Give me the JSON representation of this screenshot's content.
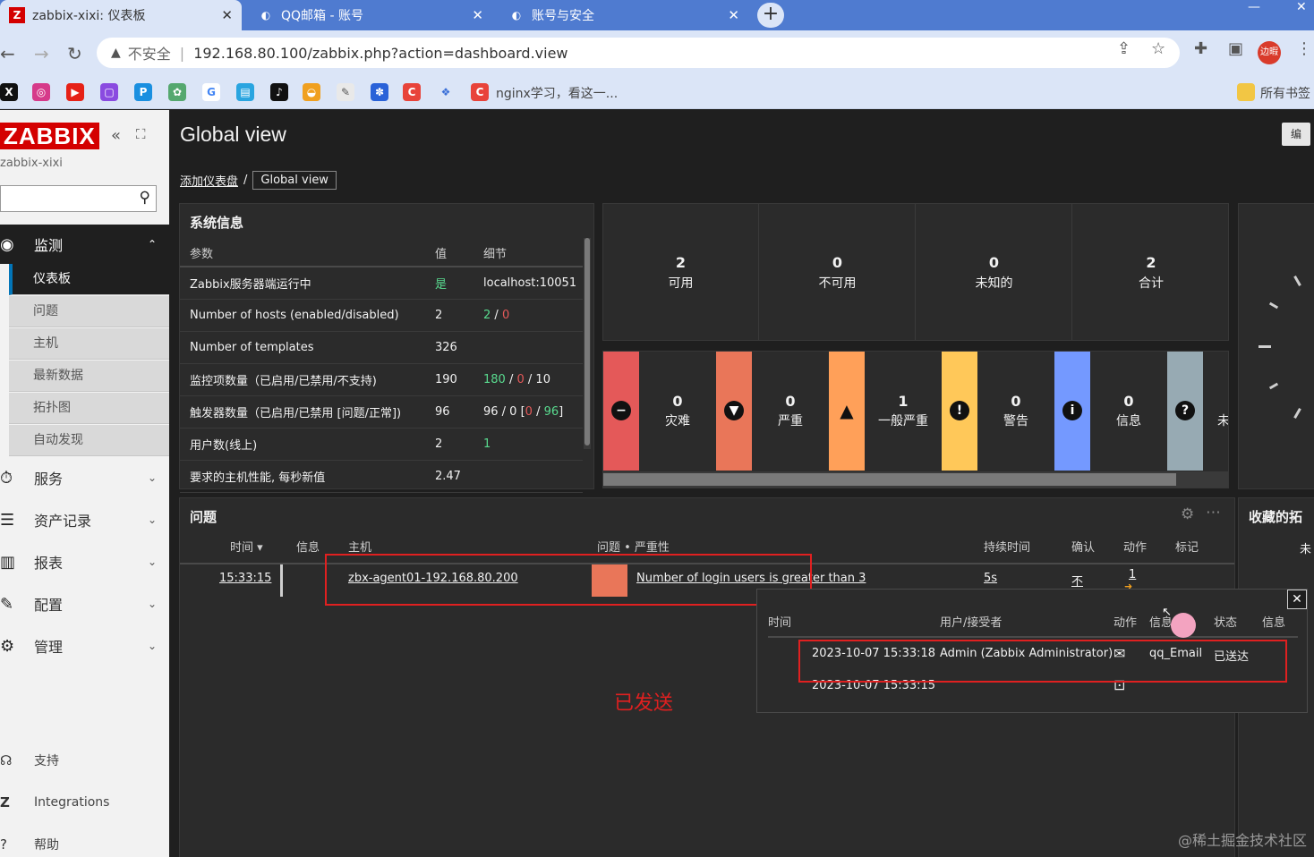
{
  "browser": {
    "tabs": [
      {
        "title": "zabbix-xixi: 仪表板",
        "icon": "Z"
      },
      {
        "title": "QQ邮箱 - 账号",
        "icon": "◐"
      },
      {
        "title": "账号与安全",
        "icon": "◐"
      }
    ],
    "insecure_label": "不安全",
    "url": "192.168.80.100/zabbix.php?action=dashboard.view",
    "profile_label": "边暇",
    "bookmark_text": "nginx学习，看这一...",
    "all_bookmarks": "所有书签",
    "colors": {
      "accent": "#4f7bd0",
      "chrome_bg": "#dbe5f7"
    }
  },
  "sidebar": {
    "logo": "ZABBIX",
    "server_name": "zabbix-xixi",
    "monitor_label": "监测",
    "submenu": [
      "仪表板",
      "问题",
      "主机",
      "最新数据",
      "拓扑图",
      "自动发现"
    ],
    "sections": [
      "服务",
      "资产记录",
      "报表",
      "配置",
      "管理"
    ],
    "bottom": [
      "支持",
      "Integrations",
      "帮助"
    ]
  },
  "main": {
    "title": "Global view",
    "edit_label": "编",
    "breadcrumb": {
      "parent": "添加仪表盘",
      "sep": "/",
      "current": "Global view"
    }
  },
  "sysinfo": {
    "title": "系统信息",
    "headers": [
      "参数",
      "值",
      "细节"
    ],
    "rows": [
      {
        "param": "Zabbix服务器端运行中",
        "value": "是",
        "detail": "localhost:10051"
      },
      {
        "param": "Number of hosts (enabled/disabled)",
        "value": "2",
        "d1": "2",
        "d2": "0"
      },
      {
        "param": "Number of templates",
        "value": "326"
      },
      {
        "param": "监控项数量（已启用/已禁用/不支持)",
        "value": "190",
        "d1": "180",
        "d2": "0",
        "d3": "10"
      },
      {
        "param": "触发器数量（已启用/已禁用 [问题/正常])",
        "value": "96",
        "d1": "96 / 0 [",
        "d2": "0",
        "d3": "96"
      },
      {
        "param": "用户数(线上)",
        "value": "2",
        "d1": "1"
      },
      {
        "param": "要求的主机性能, 每秒新值",
        "value": "2.47"
      }
    ]
  },
  "availability": [
    {
      "num": "2",
      "label": "可用"
    },
    {
      "num": "0",
      "label": "不可用"
    },
    {
      "num": "0",
      "label": "未知的"
    },
    {
      "num": "2",
      "label": "合计"
    }
  ],
  "severities": [
    {
      "num": "0",
      "label": "灾难",
      "color": "#e45959",
      "icon": "minus"
    },
    {
      "num": "0",
      "label": "严重",
      "color": "#e97659",
      "icon": "triangle-down"
    },
    {
      "num": "1",
      "label": "一般严重",
      "color": "#ffa059",
      "icon": "warning"
    },
    {
      "num": "0",
      "label": "警告",
      "color": "#ffc859",
      "icon": "exclaim"
    },
    {
      "num": "0",
      "label": "信息",
      "color": "#7499ff",
      "icon": "info"
    },
    {
      "num": "",
      "label": "",
      "color": "#97aab3",
      "icon": "question"
    }
  ],
  "problems": {
    "title": "问题",
    "headers": {
      "time": "时间 ▾",
      "info": "信息",
      "host": "主机",
      "problem": "问题 • 严重性",
      "duration": "持续时间",
      "ack": "确认",
      "actions": "动作",
      "tags": "标记"
    },
    "row": {
      "time": "15:33:15",
      "host": "zbx-agent01-192.168.80.200",
      "problem": "Number of login users is greater than 3",
      "duration": "5s",
      "ack": "不",
      "actions": "1"
    }
  },
  "favorites": {
    "title": "收藏的拓",
    "extra": "未"
  },
  "popup": {
    "headers": {
      "time": "时间",
      "user": "用户/接受者",
      "action": "动作",
      "info": "信息",
      "status": "状态",
      "info2": "信息"
    },
    "rows": [
      {
        "time": "2023-10-07 15:33:18",
        "user": "Admin (Zabbix Administrator)",
        "media": "qq_Email",
        "status": "已送达"
      },
      {
        "time": "2023-10-07 15:33:15"
      }
    ]
  },
  "annotation": "已发送",
  "watermark": "@稀土掘金技术社区"
}
